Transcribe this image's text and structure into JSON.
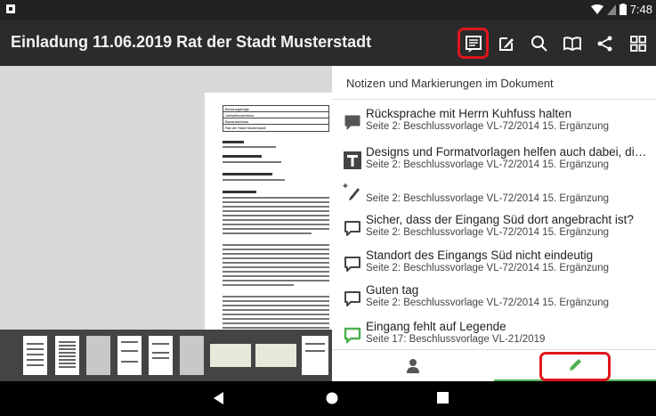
{
  "statusbar": {
    "time": "7:48",
    "colors": {
      "bg": "#222222",
      "text": "#ffffff"
    }
  },
  "appbar": {
    "title": "Einladung 11.06.2019 Rat der Stadt Musterstadt",
    "actions": [
      "notes-list-icon",
      "edit-note-icon",
      "search-icon",
      "book-icon",
      "share-icon",
      "grid-icon"
    ]
  },
  "document": {
    "table_rows": [
      "Beratungsfolge",
      "Umweltausschuss",
      "Bauausschuss",
      "Rat der Stadt Musterstadt"
    ],
    "headings": [
      "Betreff:",
      "Kreisverkehr Langestraße",
      "Beschlussvorschlag:",
      "Die Planung wird beschlossen",
      "Finanzielle Auswirkungen:",
      "Werden in der Sitzung vorgetragen.",
      "Sachdarstellung:"
    ]
  },
  "panel": {
    "header": "Notizen und Markierungen im Dokument",
    "items": [
      {
        "icon": "comment-filled-icon",
        "title": "Rücksprache mit Herrn Kuhfuss halten",
        "subtitle": "Seite 2: Beschlussvorlage VL-72/2014 15. Ergänzung"
      },
      {
        "icon": "text-annotation-icon",
        "title": "Designs und Formatvorlagen helfen auch dabei, die E...",
        "subtitle": "Seite 2: Beschlussvorlage VL-72/2014 15. Ergänzung"
      },
      {
        "icon": "magic-pen-icon",
        "title": "",
        "subtitle": "Seite 2: Beschlussvorlage VL-72/2014 15. Ergänzung"
      },
      {
        "icon": "comment-outline-icon",
        "title": "Sicher, dass der Eingang Süd dort angebracht ist?",
        "subtitle": "Seite 2: Beschlussvorlage VL-72/2014 15. Ergänzung"
      },
      {
        "icon": "comment-outline-icon",
        "title": "Standort des Eingangs Süd nicht eindeutig",
        "subtitle": "Seite 2: Beschlussvorlage VL-72/2014 15. Ergänzung"
      },
      {
        "icon": "comment-outline-icon",
        "title": "Guten tag",
        "subtitle": "Seite 2: Beschlussvorlage VL-72/2014 15. Ergänzung"
      },
      {
        "icon": "comment-outline-green-icon",
        "title": "Eingang fehlt auf Legende",
        "subtitle": "Seite 17: Beschlussvorlage VL-21/2019"
      }
    ]
  },
  "tabs": {
    "left": "person-icon",
    "right": "pencil-icon"
  },
  "colors": {
    "accent": "#4caf50",
    "highlight": "#e0151b",
    "appbar": "#2b2b2b"
  }
}
